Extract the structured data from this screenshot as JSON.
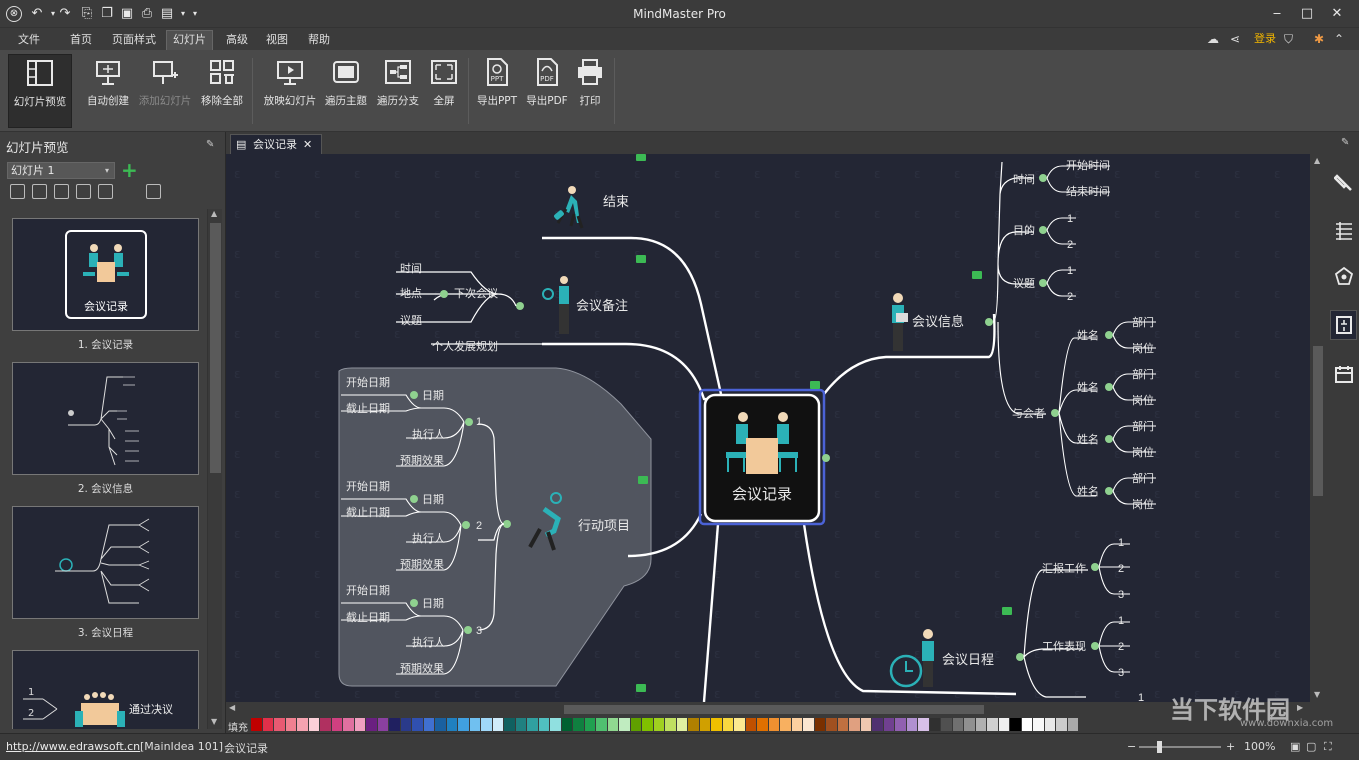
{
  "window": {
    "title": "MindMaster Pro",
    "minimize": "‒",
    "maximize": "□",
    "close": "✕"
  },
  "menu": {
    "items": [
      "文件",
      "首页",
      "页面样式",
      "幻灯片",
      "高级",
      "视图",
      "帮助"
    ],
    "active": "幻灯片",
    "login": "登录"
  },
  "ribbon": {
    "slide_preview": "幻灯片预览",
    "auto_create": "自动创建",
    "add_slide": "添加幻灯片",
    "remove_all": "移除全部",
    "play_slides": "放映幻灯片",
    "traverse_topic": "遍历主题",
    "traverse_branch": "遍历分支",
    "fullscreen": "全屏",
    "export_ppt": "导出PPT",
    "export_pdf": "导出PDF",
    "print": "打印",
    "ppt_tag": "PPT",
    "pdf_tag": "PDF"
  },
  "left_panel": {
    "title": "幻灯片预览",
    "slide_select": "幻灯片 1",
    "add": "+",
    "thumb1_title": "会议记录",
    "thumb5_title": "通过决议",
    "thumb5_items": [
      "1",
      "2"
    ],
    "captions": [
      "1. 会议记录",
      "2. 会议信息",
      "3. 会议日程"
    ]
  },
  "document_tab": {
    "label": "会议记录",
    "close": "✕"
  },
  "mindmap": {
    "central": "会议记录",
    "topics": {
      "end": "结束",
      "notes": "会议备注",
      "actions": "行动项目",
      "info": "会议信息",
      "schedule": "会议日程"
    },
    "notes_branch": {
      "next_meeting": "下次会议",
      "time": "时间",
      "place": "地点",
      "agenda": "议题",
      "plan": "个人发展规划"
    },
    "action_labels": {
      "start": "开始日期",
      "deadline": "截止日期",
      "date": "日期",
      "executor": "执行人",
      "effect": "预期效果",
      "n1": "1",
      "n2": "2",
      "n3": "3"
    },
    "info_branch": {
      "time": "时间",
      "start_time": "开始时间",
      "end_time": "结束时间",
      "purpose": "目的",
      "agenda": "议题",
      "attendees": "与会者",
      "name": "姓名",
      "dept": "部门",
      "position": "岗位",
      "one": "1",
      "two": "2"
    },
    "schedule_branch": {
      "report": "汇报工作",
      "performance": "工作表现",
      "one": "1",
      "two": "2",
      "three": "3"
    }
  },
  "palette": {
    "fill_label": "填充",
    "colors": [
      "#c00000",
      "#e0304a",
      "#e85a72",
      "#f08090",
      "#f5a3b0",
      "#fbd0d8",
      "#b03060",
      "#d04080",
      "#e070a0",
      "#f0a0c0",
      "#6a2080",
      "#8a40a0",
      "#202060",
      "#2a3a8a",
      "#3050b0",
      "#4070d0",
      "#1a60a0",
      "#2080c0",
      "#40a0e0",
      "#70c0f0",
      "#a0d8f8",
      "#d0ecfa",
      "#106060",
      "#208080",
      "#30a0a0",
      "#50c0c0",
      "#90e0e0",
      "#006030",
      "#108040",
      "#20a050",
      "#50c070",
      "#90d890",
      "#c0ecc0",
      "#60a000",
      "#80c000",
      "#a0d020",
      "#c0e060",
      "#e0f0a0",
      "#b08000",
      "#d0a000",
      "#f0c000",
      "#f8d840",
      "#fce890",
      "#c05000",
      "#e07000",
      "#f09030",
      "#f8b060",
      "#fcd0a0",
      "#fbe6d0",
      "#7a3000",
      "#a05020",
      "#c07040",
      "#e0a080",
      "#f0c8b0",
      "#503070",
      "#704090",
      "#9060b0",
      "#b090d0",
      "#d8c0e8",
      "#303030",
      "#505050",
      "#707070",
      "#909090",
      "#b0b0b0",
      "#d0d0d0",
      "#f0f0f0",
      "#000000",
      "#ffffff",
      "#f8f8f8",
      "#e8e8e8",
      "#cccccc",
      "#aaaaaa"
    ]
  },
  "status": {
    "url": "http://www.edrawsoft.cn",
    "info": "[MainIdea 101]",
    "topic": "会议记录",
    "zoom": "100%",
    "minus": "−",
    "plus": "+"
  },
  "watermark": {
    "text": "当下软件园",
    "url": "www.downxia.com"
  }
}
